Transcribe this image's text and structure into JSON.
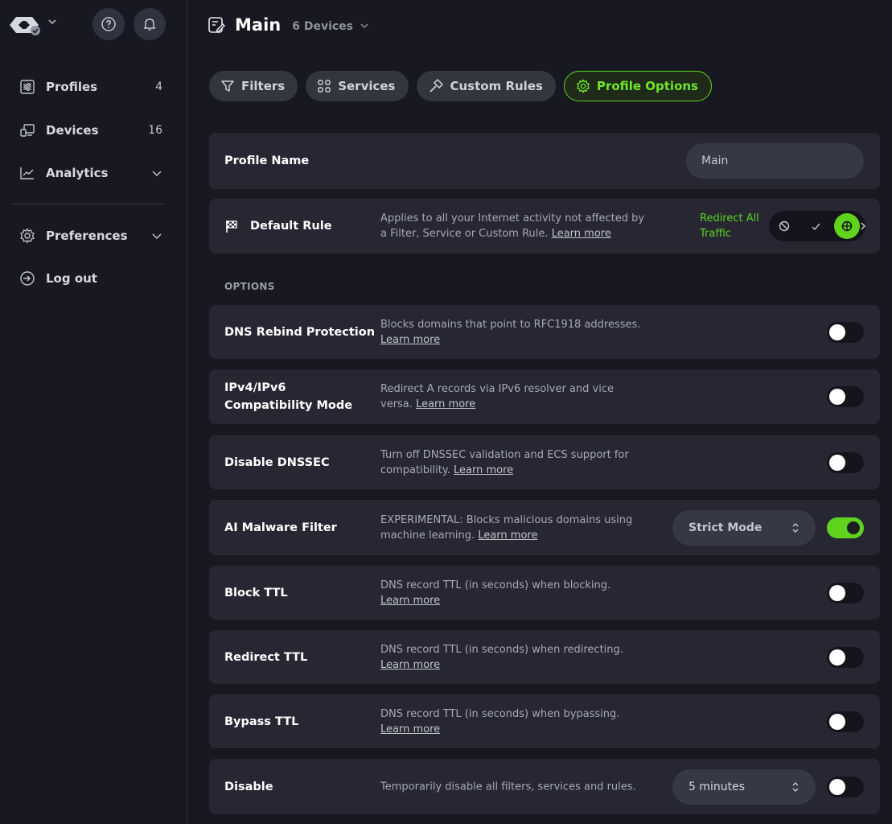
{
  "sidebar": {
    "items": [
      {
        "label": "Profiles",
        "count": "4",
        "icon": "sliders-icon"
      },
      {
        "label": "Devices",
        "count": "16",
        "icon": "devices-icon"
      },
      {
        "label": "Analytics",
        "count": "",
        "icon": "chart-icon"
      },
      {
        "label": "Preferences",
        "count": "",
        "icon": "gear-icon"
      },
      {
        "label": "Log out",
        "count": "",
        "icon": "logout-icon"
      }
    ]
  },
  "header": {
    "title": "Main",
    "devices": "6 Devices"
  },
  "tabs": [
    {
      "label": "Filters",
      "icon": "filter-icon"
    },
    {
      "label": "Services",
      "icon": "grid-icon"
    },
    {
      "label": "Custom Rules",
      "icon": "hammer-icon"
    },
    {
      "label": "Profile Options",
      "icon": "gear-icon"
    }
  ],
  "profile_name": {
    "label": "Profile Name",
    "value": "Main"
  },
  "default_rule": {
    "label": "Default Rule",
    "desc": "Applies to all your Internet activity not affected by a Filter, Service or Custom Rule.",
    "link": "Learn more",
    "mode_line1": "Redirect All",
    "mode_line2": "Traffic"
  },
  "options_label": "OPTIONS",
  "options": [
    {
      "name": "DNS Rebind Protection",
      "desc": "Blocks domains that point to RFC1918 addresses.",
      "link": "Learn more"
    },
    {
      "name1": "IPv4/IPv6",
      "name2": "Compatibility Mode",
      "desc": "Redirect A records via IPv6 resolver and vice versa.",
      "link": "Learn more"
    },
    {
      "name": "Disable DNSSEC",
      "desc": "Turn off DNSSEC validation and ECS support for compatibility.",
      "link": "Learn more"
    },
    {
      "name": "AI Malware Filter",
      "desc": "EXPERIMENTAL: Blocks malicious domains using machine learning.",
      "link": "Learn more",
      "select": "Strict Mode"
    },
    {
      "name": "Block TTL",
      "desc": "DNS record TTL (in seconds) when blocking.",
      "link": "Learn more"
    },
    {
      "name": "Redirect TTL",
      "desc": "DNS record TTL (in seconds) when redirecting.",
      "link": "Learn more"
    },
    {
      "name": "Bypass TTL",
      "desc": "DNS record TTL (in seconds) when bypassing.",
      "link": "Learn more"
    },
    {
      "name": "Disable",
      "desc": "Temporarily disable all filters, services and rules.",
      "select": "5 minutes"
    }
  ],
  "colors": {
    "accent": "#5fd31e",
    "card": "#262733",
    "bg": "#171821"
  }
}
